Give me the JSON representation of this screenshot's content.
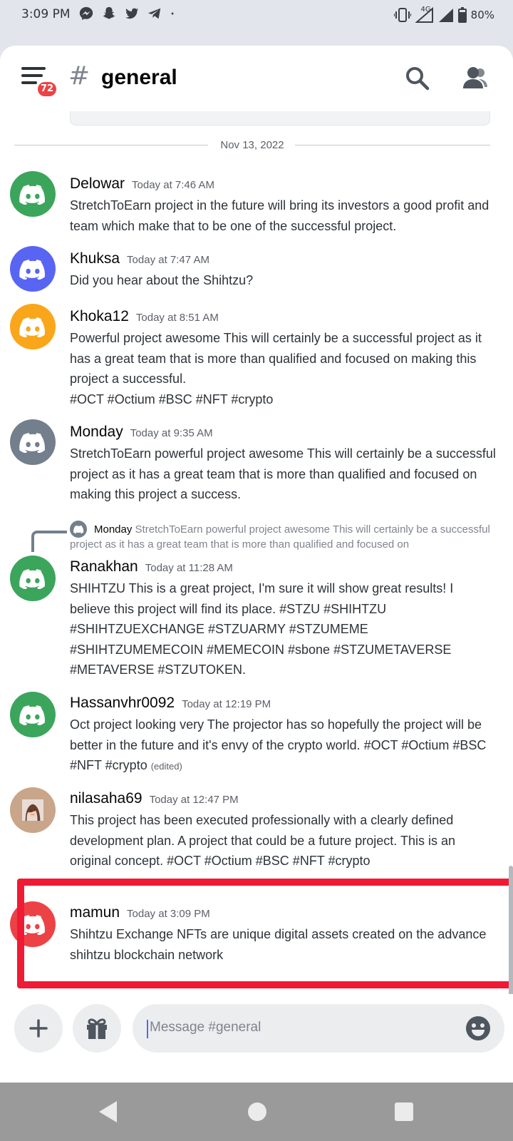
{
  "status_bar": {
    "time": "3:09 PM",
    "network": "4G",
    "battery": "80%",
    "icons": [
      "messenger-icon",
      "snapchat-icon",
      "twitter-icon",
      "telegram-icon",
      "dot-icon",
      "vibrate-icon",
      "signal-icon",
      "battery-icon"
    ]
  },
  "header": {
    "hash": "#",
    "channel": "general",
    "notification_badge": "72",
    "icons": [
      "menu-icon",
      "search-icon",
      "members-icon"
    ]
  },
  "date_divider": "Nov 13, 2022",
  "messages": [
    {
      "author": "Delowar",
      "timestamp": "Today at 7:46 AM",
      "avatar_color": "#3ba55c",
      "text": "StretchToEarn project in the future will bring its investors a good profit and  team which make that to be one of the successful project."
    },
    {
      "author": "Khuksa",
      "timestamp": "Today at 7:47 AM",
      "avatar_color": "#5865f2",
      "text": "Did you hear about the Shihtzu?"
    },
    {
      "author": "Khoka12",
      "timestamp": "Today at 8:51 AM",
      "avatar_color": "#faa61a",
      "text": "Powerful project awesome This will certainly be a successful project as it has a great team that is more than qualified and focused on making this project a successful.\n#OCT #Octium #BSC #NFT #crypto"
    },
    {
      "author": "Monday",
      "timestamp": "Today at 9:35 AM",
      "avatar_color": "#747f8d",
      "text": "StretchToEarn powerful project awesome This will certainly be a successful project as it has a great team that is more than qualified and focused on making this project a success."
    },
    {
      "author": "Ranakhan",
      "timestamp": "Today at 11:28 AM",
      "avatar_color": "#3ba55c",
      "text": "SHIHTZU This is a great project, I'm sure it will show great results! I believe this project will find its place. #STZU #SHIHTZU #SHIHTZUEXCHANGE #STZUARMY #STZUMEME #SHIHTZUMEMECOIN #MEMECOIN #sbone #STZUMETAVERSE #METAVERSE #STZUTOKEN."
    },
    {
      "author": "Hassanvhr0092",
      "timestamp": "Today at 12:19 PM",
      "avatar_color": "#3ba55c",
      "text": "Oct project looking very The projector has  so hopefully the project will be better in the future and it's envy of the crypto world. #OCT #Octium #BSC #NFT #crypto",
      "edited": "(edited)"
    },
    {
      "author": "nilasaha69",
      "timestamp": "Today at 12:47 PM",
      "avatar_color": "#c9a58a",
      "text": "This project has been executed professionally with a clearly defined development plan. A project that could be a future project. This is an original concept. #OCT #Octium #BSC #NFT #crypto"
    },
    {
      "author": "mamun",
      "timestamp": "Today at 3:09 PM",
      "avatar_color": "#ed4245",
      "text": "Shihtzu Exchange NFTs are unique digital assets created on the advance shihtzu blockchain network"
    }
  ],
  "reply": {
    "author": "Monday",
    "text": "StretchToEarn powerful project awesome This will certainly be a successful project as it has a great team that is more than qualified and focused on"
  },
  "composer": {
    "placeholder": "Message #general",
    "icons": [
      "plus-icon",
      "gift-icon",
      "emoji-icon"
    ]
  },
  "nav_bar": {
    "icons": [
      "back-icon",
      "home-icon",
      "recents-icon"
    ]
  },
  "colors": {
    "highlight": "#ef1a33",
    "blurple": "#5865f2"
  }
}
